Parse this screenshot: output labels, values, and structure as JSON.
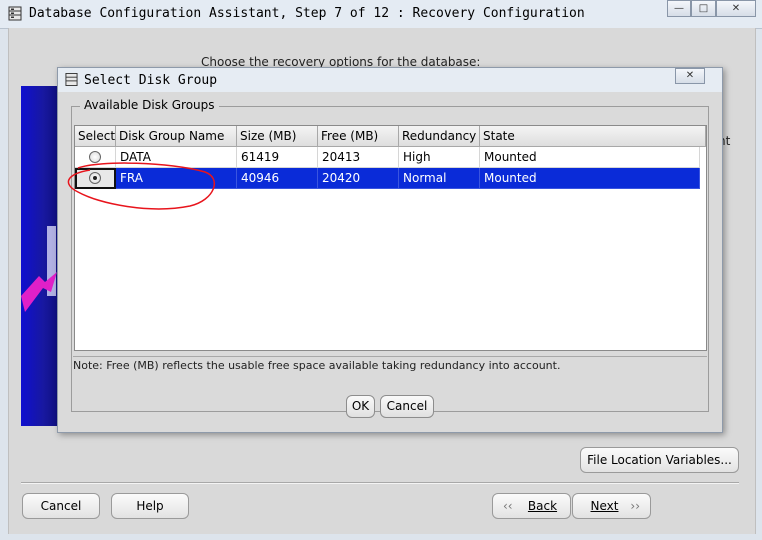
{
  "window": {
    "title": "Database Configuration Assistant, Step 7 of 12 : Recovery Configuration",
    "controls": {
      "minimize": "—",
      "maximize": "□",
      "close": "✕"
    }
  },
  "wizard": {
    "instruction": "Choose the recovery options for the database:",
    "partial_right_text": "nt",
    "file_location_button": "File Location Variables...",
    "buttons": {
      "cancel": "Cancel",
      "help": "Help",
      "back": "Back",
      "next": "Next"
    }
  },
  "dialog": {
    "title": "Select Disk Group",
    "close_glyph": "✕",
    "group_label": "Available Disk Groups",
    "columns": [
      "Select",
      "Disk Group Name",
      "Size (MB)",
      "Free (MB)",
      "Redundancy",
      "State"
    ],
    "rows": [
      {
        "name": "DATA",
        "size": "61419",
        "free": "20413",
        "redundancy": "High",
        "state": "Mounted",
        "selected": false
      },
      {
        "name": "FRA",
        "size": "40946",
        "free": "20420",
        "redundancy": "Normal",
        "state": "Mounted",
        "selected": true
      }
    ],
    "note": "Note:  Free (MB) reflects the usable free space available taking redundancy into account.",
    "ok": "OK",
    "cancel": "Cancel"
  },
  "colors": {
    "selection": "#0a2bd8",
    "annotation": "#e8141c",
    "wizard_panel": "#1414c8"
  },
  "icons": {
    "app": "database-app-icon",
    "back": "chevron-left-icon",
    "next": "chevron-right-icon"
  }
}
